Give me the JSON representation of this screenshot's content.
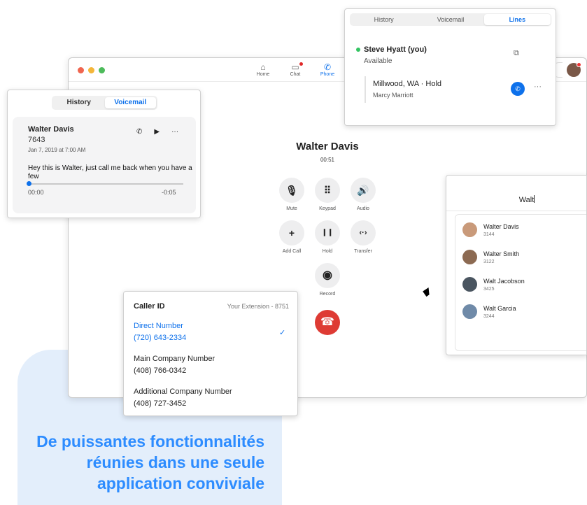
{
  "promo": {
    "line1": "De puissantes fonctionnalités",
    "line2": "réunies dans une seule",
    "line3": "application conviviale"
  },
  "nav": [
    {
      "label": "Home",
      "icon": "home-icon"
    },
    {
      "label": "Chat",
      "icon": "chat-icon"
    },
    {
      "label": "Phone",
      "icon": "phone-icon"
    }
  ],
  "call": {
    "name": "Walter Davis",
    "timer": "00:51",
    "controls": [
      {
        "label": "Mute",
        "glyph": "🎙",
        "icon": "microphone-icon"
      },
      {
        "label": "Keypad",
        "glyph": "⠿",
        "icon": "keypad-icon"
      },
      {
        "label": "Audio",
        "glyph": "🔊",
        "icon": "speaker-icon"
      },
      {
        "label": "Add Call",
        "glyph": "+",
        "icon": "plus-icon"
      },
      {
        "label": "Hold",
        "glyph": "❙❙",
        "icon": "pause-icon"
      },
      {
        "label": "Transfer",
        "glyph": "‹·›",
        "icon": "transfer-icon"
      },
      {
        "label": "Record",
        "glyph": "◉",
        "icon": "record-icon"
      }
    ],
    "end_glyph": "☎"
  },
  "voicemail": {
    "tabs": [
      "History",
      "Voicemail"
    ],
    "name": "Walter Davis",
    "ext": "7643",
    "date": "Jan 7, 2019 at 7:00 AM",
    "message": "Hey this is Walter, just call me back when you have a few",
    "start": "00:00",
    "end": "-0:05",
    "progress": 0.0
  },
  "lines": {
    "tabs": [
      "History",
      "Voicemail",
      "Lines"
    ],
    "user": "Steve Hyatt (you)",
    "status": "Available",
    "location": "Millwood, WA · Hold",
    "contact": "Marcy Marriott"
  },
  "contacts": {
    "query": "Walt",
    "items": [
      {
        "name": "Walter Davis",
        "ext": "3144",
        "color": "#c99a7a"
      },
      {
        "name": "Walter Smith",
        "ext": "3122",
        "color": "#8c6a52"
      },
      {
        "name": "Walt Jacobson",
        "ext": "3425",
        "color": "#4a5560"
      },
      {
        "name": "Walt Garcia",
        "ext": "3244",
        "color": "#6f8aa8"
      }
    ]
  },
  "caller_id": {
    "title": "Caller ID",
    "extension": "Your Extension - 8751",
    "options": [
      {
        "label": "Direct Number",
        "number": "(720) 643-2334",
        "selected": true
      },
      {
        "label": "Main Company Number",
        "number": "(408) 766-0342",
        "selected": false
      },
      {
        "label": "Additional Company Number",
        "number": "(408) 727-3452",
        "selected": false
      }
    ],
    "check": "✓"
  },
  "colors": {
    "accent": "#0e71eb",
    "promo": "#2d8cff",
    "end_call": "#de3b34",
    "available": "#33c462"
  }
}
